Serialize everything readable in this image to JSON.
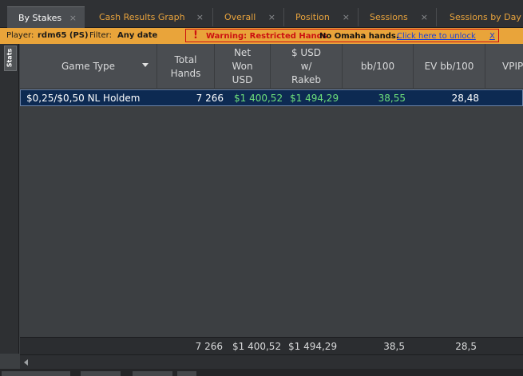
{
  "tabs": [
    {
      "label": "By Stakes",
      "active": true
    },
    {
      "label": "Cash Results Graph"
    },
    {
      "label": "Overall"
    },
    {
      "label": "Position"
    },
    {
      "label": "Sessions"
    },
    {
      "label": "Sessions by Day"
    }
  ],
  "close_glyph": "×",
  "infobar": {
    "player_label": "Player:",
    "player_value": "rdm65 (PS)",
    "filter_label": "Filter:",
    "filter_value": "Any date",
    "warning_icon": "!",
    "warning_text": "Warning: Restricted Hands",
    "no_omaha": "No Omaha hands.",
    "unlock_link": "Click here to unlock",
    "dismiss_link": "X"
  },
  "side_tab": "Stats",
  "columns": [
    "Game Type",
    "Total Hands",
    "Net Won USD",
    "$ USD w/ Rakeb",
    "bb/100",
    "EV bb/100",
    "VPIP"
  ],
  "rows": [
    {
      "game_type": "$0,25/$0,50 NL Holdem",
      "total_hands": "7 266",
      "net_won": "$1 400,52",
      "usd_rakeb": "$1 494,29",
      "bb100": "38,55",
      "ev_bb100": "28,48"
    }
  ],
  "totals": {
    "total_hands": "7 266",
    "net_won": "$1 400,52",
    "usd_rakeb": "$1 494,29",
    "bb100": "38,5",
    "ev_bb100": "28,5"
  },
  "colors": {
    "accent_orange": "#e8a33d",
    "warning_red": "#cc1111",
    "positive_green": "#6ee07a",
    "selected_row": "#0d2a52"
  }
}
